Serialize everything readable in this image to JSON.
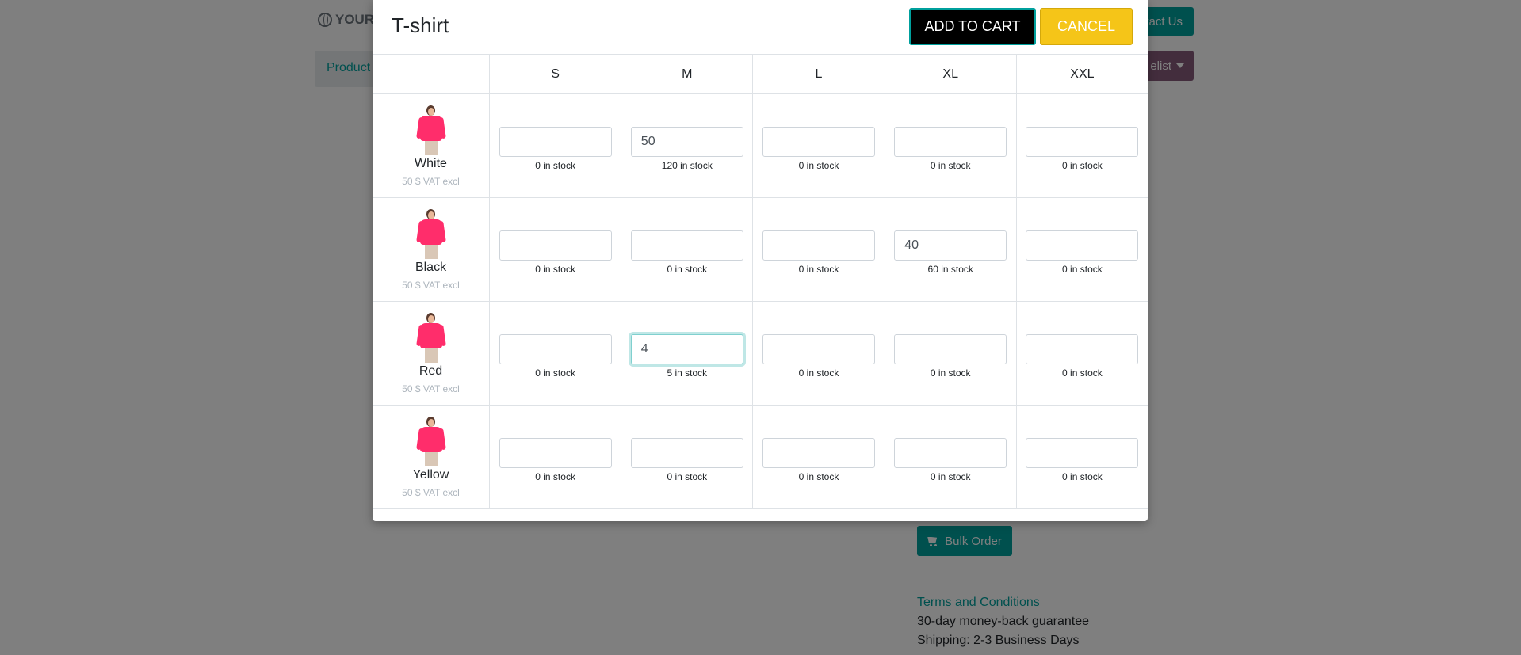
{
  "background": {
    "brand": "YOUR",
    "contact_label": "tact Us",
    "products_label": "Product",
    "pricelist_label": "elist",
    "bulk_order_label": "Bulk Order",
    "terms_title": "Terms and Conditions",
    "terms_line1": "30-day money-back guarantee",
    "terms_line2": "Shipping: 2-3 Business Days"
  },
  "modal": {
    "title": "T-shirt",
    "add_to_cart_label": "ADD TO CART",
    "cancel_label": "CANCEL",
    "sizes": [
      "S",
      "M",
      "L",
      "XL",
      "XXL"
    ],
    "variants": [
      {
        "color": "White",
        "price": "50 $ VAT excl",
        "cells": [
          {
            "value": "",
            "stock": "0 in stock"
          },
          {
            "value": "50",
            "stock": "120 in stock"
          },
          {
            "value": "",
            "stock": "0 in stock"
          },
          {
            "value": "",
            "stock": "0 in stock"
          },
          {
            "value": "",
            "stock": "0 in stock"
          }
        ]
      },
      {
        "color": "Black",
        "price": "50 $ VAT excl",
        "cells": [
          {
            "value": "",
            "stock": "0 in stock"
          },
          {
            "value": "",
            "stock": "0 in stock"
          },
          {
            "value": "",
            "stock": "0 in stock"
          },
          {
            "value": "40",
            "stock": "60 in stock"
          },
          {
            "value": "",
            "stock": "0 in stock"
          }
        ]
      },
      {
        "color": "Red",
        "price": "50 $ VAT excl",
        "cells": [
          {
            "value": "",
            "stock": "0 in stock"
          },
          {
            "value": "4",
            "stock": "5 in stock"
          },
          {
            "value": "",
            "stock": "0 in stock"
          },
          {
            "value": "",
            "stock": "0 in stock"
          },
          {
            "value": "",
            "stock": "0 in stock"
          }
        ]
      },
      {
        "color": "Yellow",
        "price": "50 $ VAT excl",
        "cells": [
          {
            "value": "",
            "stock": "0 in stock"
          },
          {
            "value": "",
            "stock": "0 in stock"
          },
          {
            "value": "",
            "stock": "0 in stock"
          },
          {
            "value": "",
            "stock": "0 in stock"
          },
          {
            "value": "",
            "stock": "0 in stock"
          }
        ]
      }
    ]
  },
  "colors": {
    "accent": "#00a09d",
    "pricelist": "#875a7b",
    "cancel": "#f5c518",
    "add_to_cart": "#000000"
  }
}
